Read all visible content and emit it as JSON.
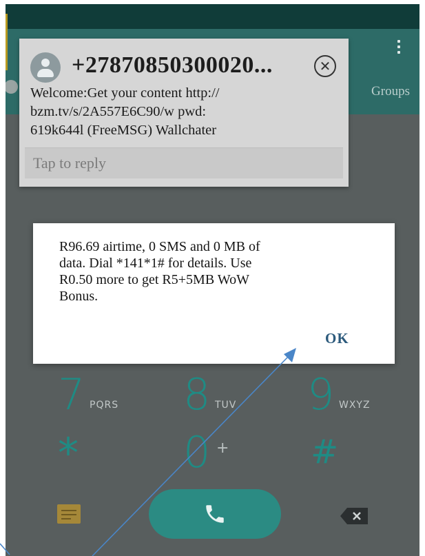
{
  "header": {
    "tab_groups": "Groups",
    "menu_icon": "overflow-menu-icon"
  },
  "notification": {
    "sender": "+27870850300020...",
    "message": "Welcome:Get your content http://\nbzm.tv/s/2A557E6C90/w pwd:\n619k644l (FreeMSG) Wallchater",
    "reply_placeholder": "Tap to reply",
    "icons": [
      "avatar-icon",
      "close-icon"
    ]
  },
  "dialog": {
    "message": "R96.69 airtime, 0 SMS and 0 MB of\ndata. Dial *141*1# for details. Use\nR0.50 more to get R5+5MB WoW\nBonus.",
    "ok_label": "OK"
  },
  "dialpad": {
    "keys": [
      {
        "digit": "7",
        "letters": "PQRS"
      },
      {
        "digit": "8",
        "letters": "TUV"
      },
      {
        "digit": "9",
        "letters": "WXYZ"
      },
      {
        "digit": "*",
        "letters": ""
      },
      {
        "digit": "0",
        "letters": "+"
      },
      {
        "digit": "#",
        "letters": ""
      }
    ],
    "icons": [
      "message-icon",
      "phone-icon",
      "backspace-icon"
    ]
  },
  "colors": {
    "accent": "#1f8b84",
    "appbar": "#2d6b67",
    "statusbar": "#103c39",
    "ok_text": "#2c5a7c"
  }
}
